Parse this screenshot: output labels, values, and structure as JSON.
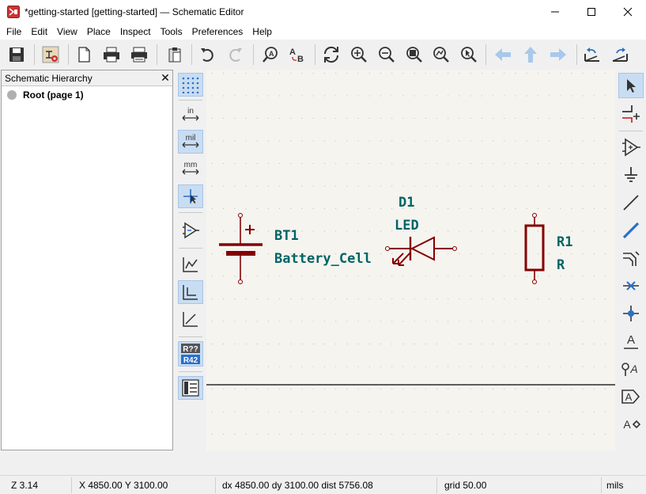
{
  "window": {
    "title": "*getting-started [getting-started] — Schematic Editor"
  },
  "menu": {
    "items": [
      "File",
      "Edit",
      "View",
      "Place",
      "Inspect",
      "Tools",
      "Preferences",
      "Help"
    ]
  },
  "hierarchy": {
    "title": "Schematic Hierarchy",
    "close": "✕",
    "root_label": "Root (page 1)"
  },
  "left_toolbar": {
    "units": {
      "in": "in",
      "mil": "mil",
      "mm": "mm"
    },
    "annotate": {
      "top": "R??",
      "bottom": "R42"
    }
  },
  "schematic": {
    "battery": {
      "ref": "BT1",
      "value": "Battery_Cell",
      "plus": "+"
    },
    "led": {
      "ref": "D1",
      "value": "LED"
    },
    "resistor": {
      "ref": "R1",
      "value": "R"
    }
  },
  "status": {
    "zoom": "Z 3.14",
    "cursor": "X 4850.00  Y 3100.00",
    "delta": "dx 4850.00  dy 3100.00  dist 5756.08",
    "grid": "grid 50.00",
    "units": "mils"
  },
  "colors": {
    "symbol_body": "#840000",
    "symbol_text": "#006464",
    "canvas_bg": "#f5f4ef",
    "accent": "#4a90d9"
  }
}
